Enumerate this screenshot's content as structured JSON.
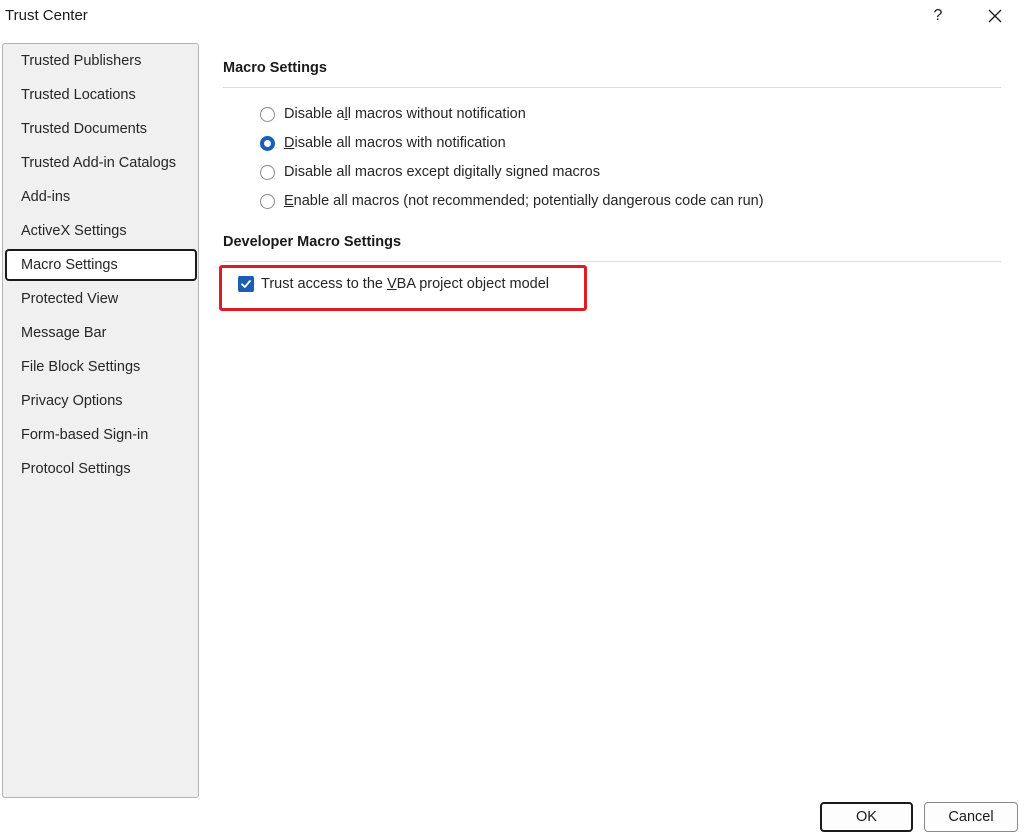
{
  "window": {
    "title": "Trust Center",
    "help_label": "?"
  },
  "nav": {
    "items": [
      {
        "label": "Trusted Publishers"
      },
      {
        "label": "Trusted Locations"
      },
      {
        "label": "Trusted Documents"
      },
      {
        "label": "Trusted Add-in Catalogs"
      },
      {
        "label": "Add-ins"
      },
      {
        "label": "ActiveX Settings"
      },
      {
        "label": "Macro Settings"
      },
      {
        "label": "Protected View"
      },
      {
        "label": "Message Bar"
      },
      {
        "label": "File Block Settings"
      },
      {
        "label": "Privacy Options"
      },
      {
        "label": "Form-based Sign-in"
      },
      {
        "label": "Protocol Settings"
      }
    ],
    "selected": "Macro Settings"
  },
  "macro_settings": {
    "heading": "Macro Settings",
    "options": [
      {
        "pre": "Disable a",
        "key": "l",
        "post": "l macros without notification",
        "checked": false
      },
      {
        "pre": "",
        "key": "D",
        "post": "isable all macros with notification",
        "checked": true
      },
      {
        "pre": "Disable all macros except di",
        "key": "g",
        "post": "itally signed macros",
        "checked": false
      },
      {
        "pre": "",
        "key": "E",
        "post": "nable all macros (not recommended; potentially dangerous code can run)",
        "checked": false
      }
    ]
  },
  "developer_macro_settings": {
    "heading": "Developer Macro Settings",
    "trust_vba": {
      "pre": "Trust access to the ",
      "key": "V",
      "post": "BA project object model",
      "checked": true
    }
  },
  "footer": {
    "ok_label": "OK",
    "cancel_label": "Cancel"
  },
  "colors": {
    "accent": "#1a5fb4",
    "highlight": "#e01b24"
  }
}
